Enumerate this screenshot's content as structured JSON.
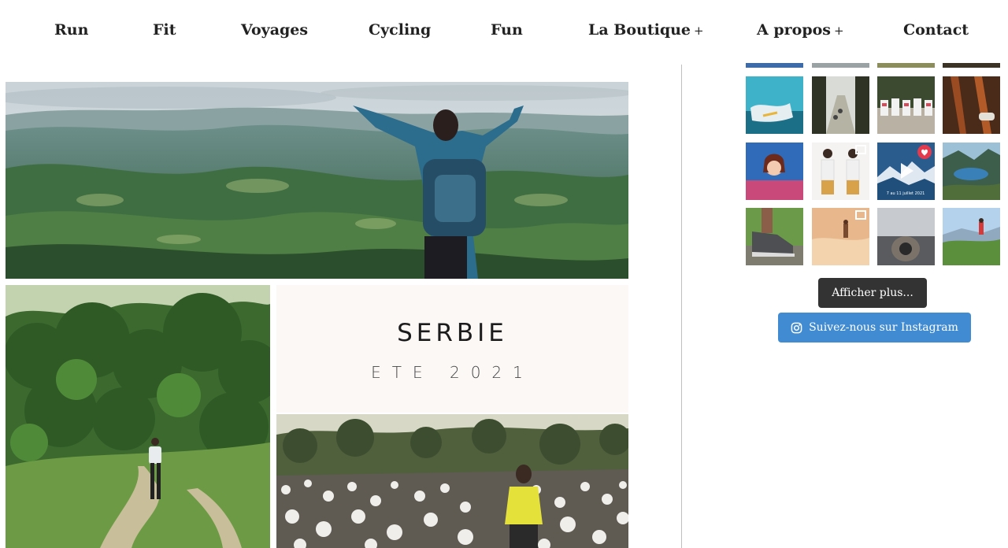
{
  "nav": {
    "items": [
      {
        "label": "Run"
      },
      {
        "label": "Fit"
      },
      {
        "label": "Voyages"
      },
      {
        "label": "Cycling"
      },
      {
        "label": "Fun"
      },
      {
        "label": "La Boutique",
        "has_submenu": true
      },
      {
        "label": "A propos",
        "has_submenu": true
      },
      {
        "label": "Contact"
      }
    ],
    "submenu_marker": "+"
  },
  "article": {
    "title": "SERBIE",
    "subtitle": "ETE 2021"
  },
  "instagram": {
    "load_more_label": "Afficher plus...",
    "follow_label": "Suivez-nous sur Instagram",
    "follow_icon": "instagram-icon",
    "reel_caption": "7 au 11 juillet 2021"
  },
  "colors": {
    "follow_button": "#408bd1",
    "load_more_button": "#333333",
    "divider": "#bfbfbf"
  }
}
